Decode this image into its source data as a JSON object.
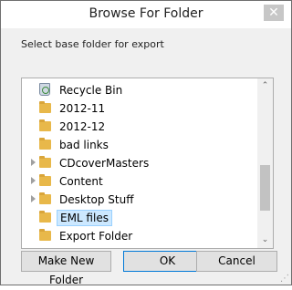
{
  "dialog": {
    "title": "Browse For Folder",
    "close_glyph": "✕",
    "instruction": "Select base folder for export"
  },
  "tree": {
    "items": [
      {
        "label": "Recycle Bin",
        "icon": "recycle-bin-icon",
        "expandable": false,
        "selected": false
      },
      {
        "label": "2012-11",
        "icon": "folder-icon",
        "expandable": false,
        "selected": false
      },
      {
        "label": "2012-12",
        "icon": "folder-icon",
        "expandable": false,
        "selected": false
      },
      {
        "label": "bad links",
        "icon": "folder-icon",
        "expandable": false,
        "selected": false
      },
      {
        "label": "CDcoverMasters",
        "icon": "folder-icon",
        "expandable": true,
        "selected": false
      },
      {
        "label": "Content",
        "icon": "folder-icon",
        "expandable": true,
        "selected": false
      },
      {
        "label": "Desktop Stuff",
        "icon": "folder-icon",
        "expandable": true,
        "selected": false
      },
      {
        "label": "EML files",
        "icon": "folder-icon",
        "expandable": false,
        "selected": true
      },
      {
        "label": "Export Folder",
        "icon": "folder-icon",
        "expandable": false,
        "selected": false
      }
    ],
    "scroll_up_glyph": "⌃",
    "scroll_down_glyph": "⌄"
  },
  "buttons": {
    "new_folder": "Make New Folder",
    "ok": "OK",
    "cancel": "Cancel"
  }
}
